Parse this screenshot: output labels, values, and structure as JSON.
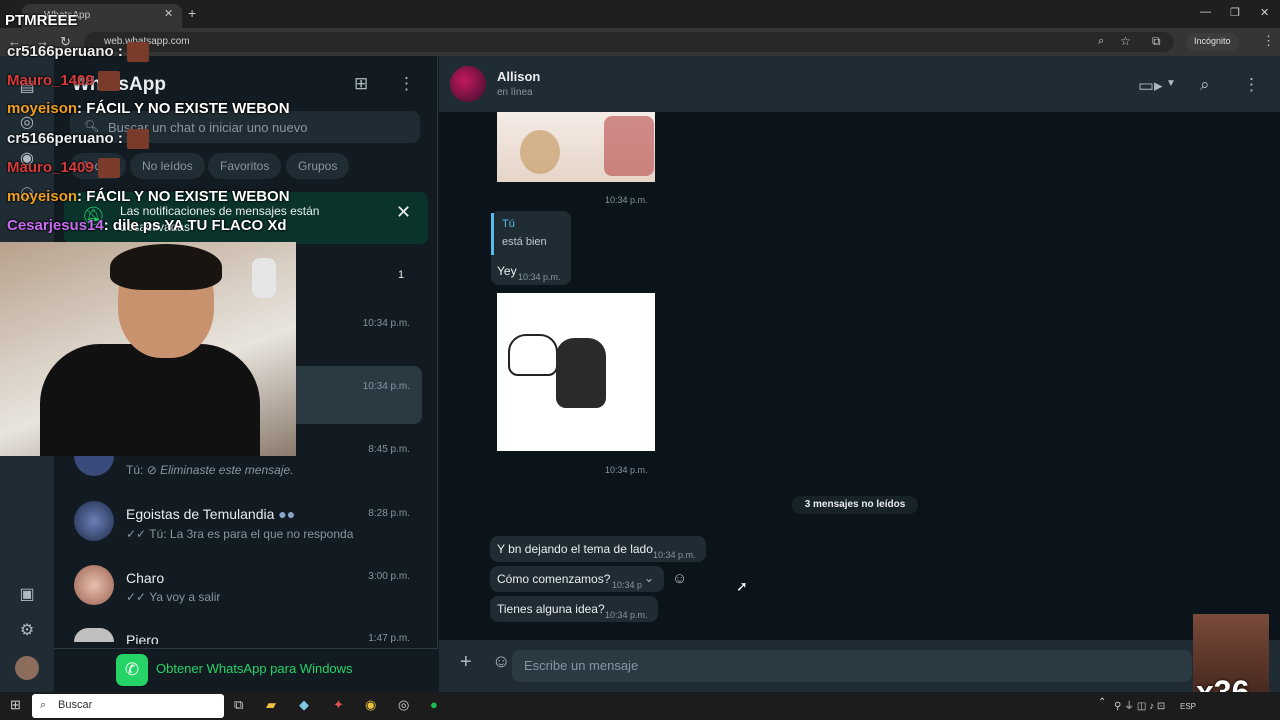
{
  "browser": {
    "tab_title": "WhatsApp",
    "url": "web.whatsapp.com",
    "profile_label": "Incógnito"
  },
  "sidebar": {
    "app_title": "WhatsApp",
    "search_placeholder": "Buscar un chat o iniciar uno nuevo",
    "filters": [
      "Todos",
      "No leídos",
      "Favoritos",
      "Grupos"
    ],
    "notification": "Las notificaciones de mensajes están desactivadas",
    "unread_badge": "1",
    "chats": [
      {
        "time": "10:34 p.m."
      },
      {
        "time": "10:34 p.m."
      },
      {
        "time": "8:45 p.m.",
        "preview_prefix": "Tú:",
        "preview": "Eliminaste este mensaje."
      },
      {
        "name": "Egoistas de Temulandia",
        "time": "8:28 p.m.",
        "preview": "Tú: La 3ra es para el que no responda"
      },
      {
        "name": "Charo",
        "time": "3:00 p.m.",
        "preview": "Ya voy a salir"
      },
      {
        "name": "Piero",
        "time": "1:47 p.m."
      }
    ],
    "get_app": "Obtener WhatsApp para Windows"
  },
  "chat": {
    "contact_name": "Allison",
    "status": "en línea",
    "messages": [
      {
        "kind": "sticker",
        "time": "10:34 p.m."
      },
      {
        "kind": "reply",
        "quoted_author": "Tú",
        "quoted_text": "está bien",
        "text": "Yey",
        "time": "10:34 p.m."
      },
      {
        "kind": "sticker",
        "time": "10:34 p.m."
      },
      {
        "kind": "text",
        "text": "Y bn dejando el tema de lado",
        "time": "10:34 p.m."
      },
      {
        "kind": "text",
        "text": "Cómo comenzamos?",
        "time": "10:34 p"
      },
      {
        "kind": "text",
        "text": "Tienes alguna idea?",
        "time": "10:34 p.m."
      }
    ],
    "unread_divider": "3 mensajes no leídos",
    "composer_placeholder": "Escribe un mensaje"
  },
  "stream_overlay": {
    "chat_lines": [
      {
        "user": "cr5166peruano",
        "text": ":",
        "color": "#e9edef"
      },
      {
        "user": "Mauro_1409",
        "text": "",
        "color": "#d63b3b"
      },
      {
        "user": "moyeison",
        "text": ": FÁCIL Y NO EXISTE WEBON",
        "color": "#f0a020"
      },
      {
        "user": "cr5166peruano",
        "text": ":",
        "color": "#e9edef"
      },
      {
        "user": "Mauro_1409",
        "text": "",
        "color": "#d63b3b"
      },
      {
        "user": "moyeison",
        "text": ": FÁCIL Y NO EXISTE WEBON",
        "color": "#f0a020"
      },
      {
        "user": "Cesarjesus14",
        "text": ": dile ps YA TU FLACO Xd",
        "color": "#c86cf0"
      }
    ],
    "top_text": "PTMREEE",
    "multiplier": "x36"
  },
  "taskbar": {
    "search_label": "Buscar",
    "lang": "ESP"
  },
  "colors": {
    "accent": "#25d366",
    "panel": "#202c33",
    "background": "#111b21"
  }
}
